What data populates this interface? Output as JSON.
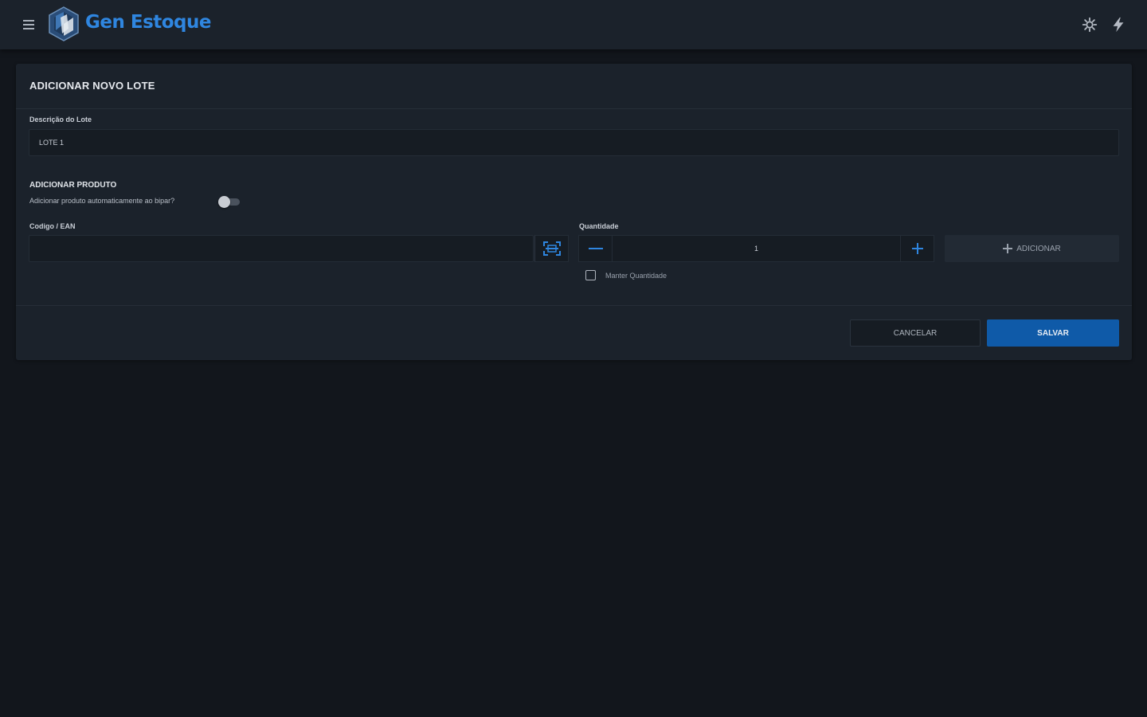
{
  "app": {
    "brand": "Gen Estoque"
  },
  "header": {
    "icons": [
      "menu-icon",
      "gear-icon",
      "bolt-icon"
    ],
    "accent_color": "#2f86e0"
  },
  "form": {
    "title": "ADICIONAR NOVO LOTE",
    "description_label": "Descrição do Lote",
    "description_value": "LOTE 1",
    "add_product_title": "ADICIONAR PRODUTO",
    "auto_add_label": "Adicionar produto automaticamente ao bipar?",
    "auto_add_enabled": false,
    "code_label": "Codigo / EAN",
    "code_value": "",
    "quantity_label": "Quantidade",
    "quantity_value": "1",
    "add_button_label": "ADICIONAR",
    "keep_quantity_label": "Manter Quantidade",
    "keep_quantity_checked": false
  },
  "actions": {
    "cancel_label": "CANCELAR",
    "save_label": "SALVAR",
    "save_color": "#0f5aa8"
  }
}
